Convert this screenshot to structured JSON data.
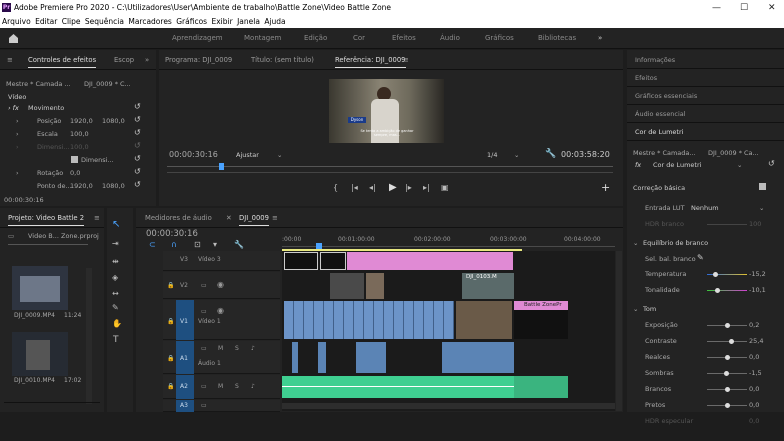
{
  "window": {
    "title": "Adobe Premiere Pro 2020 - C:\\Utilizadores\\User\\Ambiente de trabalho\\Battle Zone\\Video Battle Zone",
    "logo": "Pr",
    "min": "—",
    "max": "☐",
    "close": "✕"
  },
  "menu": [
    "Arquivo",
    "Editar",
    "Clipe",
    "Sequência",
    "Marcadores",
    "Gráficos",
    "Exibir",
    "Janela",
    "Ajuda"
  ],
  "workspaces": [
    "Aprendizagem",
    "Montagem",
    "Edição",
    "Cor",
    "Efeitos",
    "Áudio",
    "Gráficos",
    "Bibliotecas"
  ],
  "effects": {
    "tab1": "Controles de efeitos",
    "tab2": "Escop",
    "master": "Mestre * Camada ...",
    "clip": "DJI_0009 * C...",
    "video": "Vídeo",
    "motion": "Movimento",
    "pos_label": "Posição",
    "pos_x": "1920,0",
    "pos_y": "1080,0",
    "scale_label": "Escala",
    "scale_val": "100,0",
    "dim_label": "Dimensi...",
    "dim_val": "100,0",
    "dim_check": "Dimensi...",
    "rot_label": "Rotação",
    "rot_val": "0,0",
    "anchor_label": "Ponto de...",
    "anchor_x": "1920,0",
    "anchor_y": "1080,0",
    "timecode": "00:00:30:16"
  },
  "monitor": {
    "tab_program": "Programa: DJI_0009",
    "tab_title": "Título: (sem título)",
    "tab_ref": "Referência: DJI_0009",
    "timecode": "00:00:30:16",
    "fit": "Ajustar",
    "ratio": "1/4",
    "duration": "00:03:58:20",
    "subtitle": "Se tenta a ambição de ganhar sempre, mas...",
    "name_tag": "Dyson"
  },
  "project": {
    "tab": "Projeto: Video Battle 2",
    "file": "Video B... Zone.prproj",
    "items": [
      {
        "name": "DJI_0009.MP4",
        "dur": "11:24"
      },
      {
        "name": "DJI_0010.MP4",
        "dur": "17:02"
      }
    ]
  },
  "timeline": {
    "tab1": "Medidores de áudio",
    "tab2": "DJI_0009",
    "timecode": "00:00:30:16",
    "ruler": [
      ":00:00",
      "00:01:00:00",
      "00:02:00:00",
      "00:03:00:00",
      "00:04:00:00"
    ],
    "tracks": [
      {
        "id": "V3",
        "name": "Vídeo 3"
      },
      {
        "id": "V2",
        "name": ""
      },
      {
        "id": "V1",
        "name": "Vídeo 1"
      },
      {
        "id": "A1",
        "name": "Áudio 1"
      },
      {
        "id": "A2",
        "name": ""
      },
      {
        "id": "A3",
        "name": ""
      }
    ],
    "clip_v2": "DJI_0103.M",
    "clip_v1": "Battle ZonePr",
    "m": "M",
    "s": "S"
  },
  "panels": {
    "right": [
      "Informações",
      "Efeitos",
      "Gráficos essenciais",
      "Áudio essencial"
    ],
    "lumetri": "Cor de Lumetri"
  },
  "lumetri": {
    "master": "Mestre * Camada...",
    "clip": "DJI_0009 * Ca...",
    "fx": "Cor de Lumetri",
    "basic": "Correção básica",
    "lut_label": "Entrada LUT",
    "lut_val": "Nenhum",
    "hdr_label": "HDR branco",
    "hdr_val": "100",
    "wb": "Equilíbrio de branco",
    "wb_sel": "Sel. bal. branco",
    "temp_label": "Temperatura",
    "temp_val": "-15,2",
    "tint_label": "Tonalidade",
    "tint_val": "-10,1",
    "tone": "Tom",
    "exp_label": "Exposição",
    "exp_val": "0,2",
    "con_label": "Contraste",
    "con_val": "25,4",
    "hl_label": "Realces",
    "hl_val": "0,0",
    "sh_label": "Sombras",
    "sh_val": "-1,5",
    "wh_label": "Brancos",
    "wh_val": "0,0",
    "bk_label": "Pretos",
    "bk_val": "0,0",
    "hdrs_label": "HDR especular",
    "hdrs_val": "0,0"
  },
  "colors": {
    "accent": "#4aa3ff",
    "pink": "#e08ad4",
    "audio_green": "#3fcf91",
    "video_blue": "#6c94c8"
  }
}
